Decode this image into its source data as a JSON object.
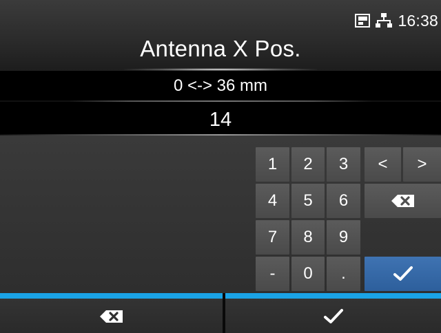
{
  "status": {
    "clock": "16:38",
    "icons": [
      "sd-card-icon",
      "network-icon"
    ]
  },
  "header": {
    "title": "Antenna X Pos."
  },
  "range": {
    "label": "0 <-> 36 mm"
  },
  "value": {
    "current": "14"
  },
  "keypad": {
    "keys": {
      "k1": "1",
      "k2": "2",
      "k3": "3",
      "k4": "4",
      "k5": "5",
      "k6": "6",
      "k7": "7",
      "k8": "8",
      "k9": "9",
      "minus": "-",
      "k0": "0",
      "dot": ".",
      "left": "<",
      "right": ">"
    },
    "icons": {
      "backspace": "backspace-icon",
      "enter": "checkmark-icon"
    }
  },
  "footer": {
    "cancel_icon": "backspace-icon",
    "confirm_icon": "checkmark-icon"
  },
  "colors": {
    "accent": "#1aa3e6",
    "ok_key": "#3f73b2"
  }
}
